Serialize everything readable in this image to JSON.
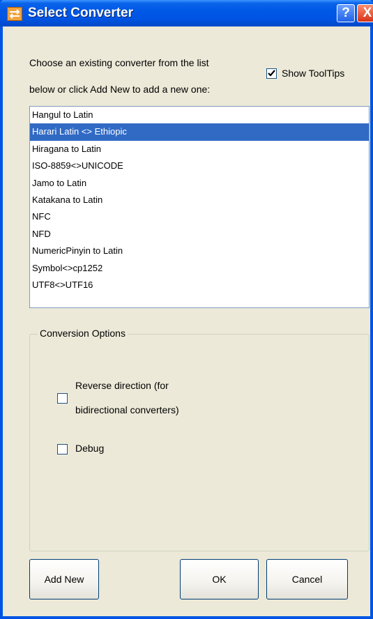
{
  "window": {
    "title": "Select Converter",
    "help_glyph": "?",
    "close_glyph": "X",
    "accent": "#0054e3"
  },
  "intro": {
    "line1": "Choose an existing converter from the list",
    "line2": "below or click Add New to add a new one:"
  },
  "tooltips": {
    "label": "Show ToolTips",
    "checked": true
  },
  "converters": {
    "items": [
      "Hangul to Latin",
      "Harari Latin <> Ethiopic",
      "Hiragana to Latin",
      "ISO-8859<>UNICODE",
      "Jamo to Latin",
      "Katakana to Latin",
      "NFC",
      "NFD",
      "NumericPinyin to Latin",
      "Symbol<>cp1252",
      "UTF8<>UTF16"
    ],
    "selected_index": 1,
    "selection_color": "#316ac5"
  },
  "options": {
    "legend": "Conversion Options",
    "reverse_line1": "Reverse direction (for",
    "reverse_line2": "bidirectional converters)",
    "reverse_checked": false,
    "debug_label": "Debug",
    "debug_checked": false
  },
  "buttons": {
    "add_new": "Add New",
    "ok": "OK",
    "cancel": "Cancel"
  }
}
